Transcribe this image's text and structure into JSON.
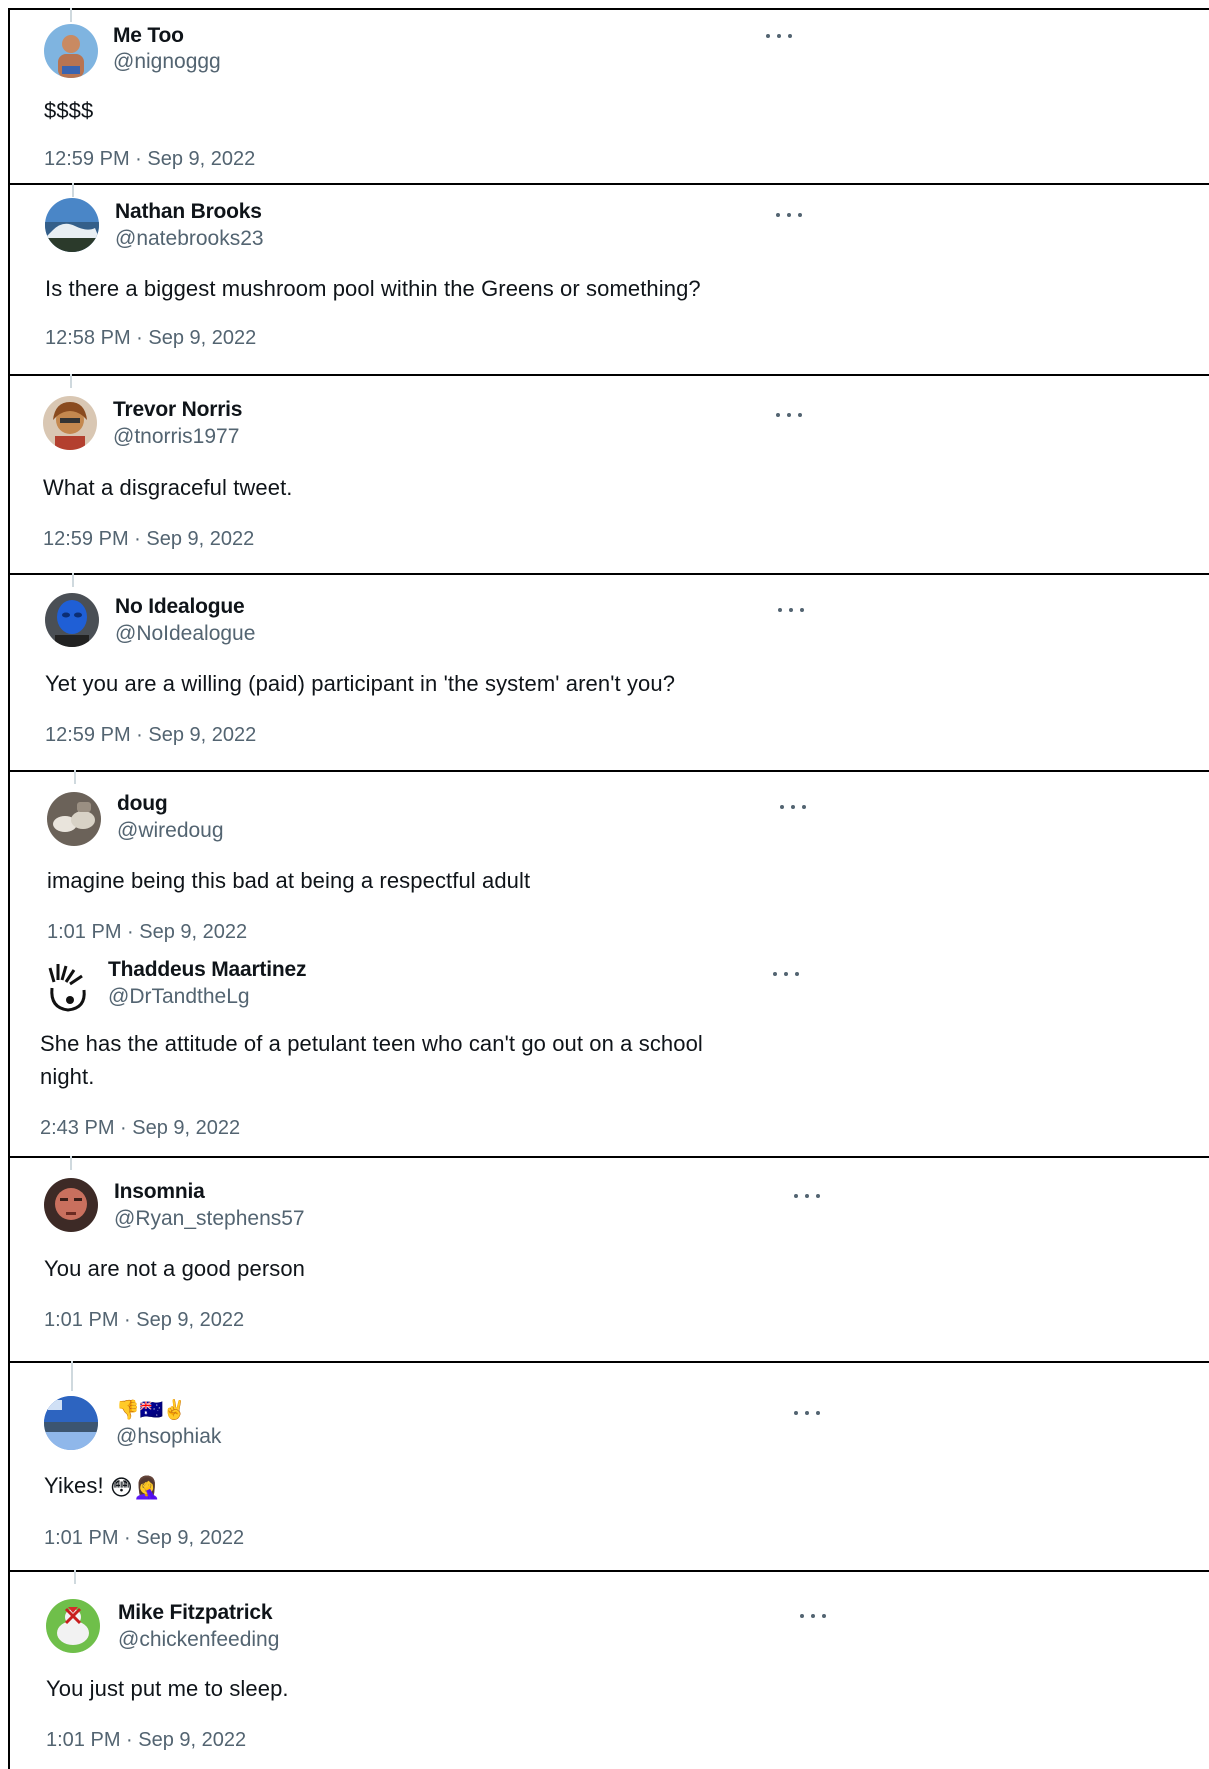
{
  "tweets": [
    {
      "name": "Me Too",
      "handle": "@nignoggg",
      "text": "$$$$",
      "time": "12:59 PM · Sep 9, 2022"
    },
    {
      "name": "Nathan Brooks",
      "handle": "@natebrooks23",
      "text": "Is there a biggest mushroom pool within the Greens or something?",
      "time": "12:58 PM · Sep 9, 2022"
    },
    {
      "name": "Trevor Norris",
      "handle": "@tnorris1977",
      "text": "What a disgraceful tweet.",
      "time": "12:59 PM · Sep 9, 2022"
    },
    {
      "name": "No Idealogue",
      "handle": "@NoIdealogue",
      "text": "Yet you are a willing (paid) participant in 'the system' aren't you?",
      "time": "12:59 PM · Sep 9, 2022"
    },
    {
      "name": "doug",
      "handle": "@wiredoug",
      "text": "imagine being this bad at being a respectful adult",
      "time": "1:01 PM · Sep 9, 2022"
    },
    {
      "name": "Thaddeus Maartinez",
      "handle": "@DrTandtheLg",
      "text_line1": "She has the attitude of a petulant teen who can't go out on a school",
      "text_line2": "night.",
      "time": "2:43 PM · Sep 9, 2022"
    },
    {
      "name": "Insomnia",
      "handle": "@Ryan_stephens57",
      "text": "You are not a good person",
      "time": "1:01 PM · Sep 9, 2022"
    },
    {
      "name": "👎🇦🇺✌️",
      "handle": "@hsophiak",
      "text": "Yikes!",
      "text_emoji": "😳🤦‍♀️",
      "time": "1:01 PM · Sep 9, 2022"
    },
    {
      "name": "Mike Fitzpatrick",
      "handle": "@chickenfeeding",
      "text": "You just put me to sleep.",
      "time": "1:01 PM · Sep 9, 2022"
    }
  ],
  "icons": {
    "more": "more-horizontal-icon",
    "avatar": "avatar"
  },
  "colors": {
    "text": "#0f1419",
    "secondary": "#536471",
    "border": "#000000"
  }
}
